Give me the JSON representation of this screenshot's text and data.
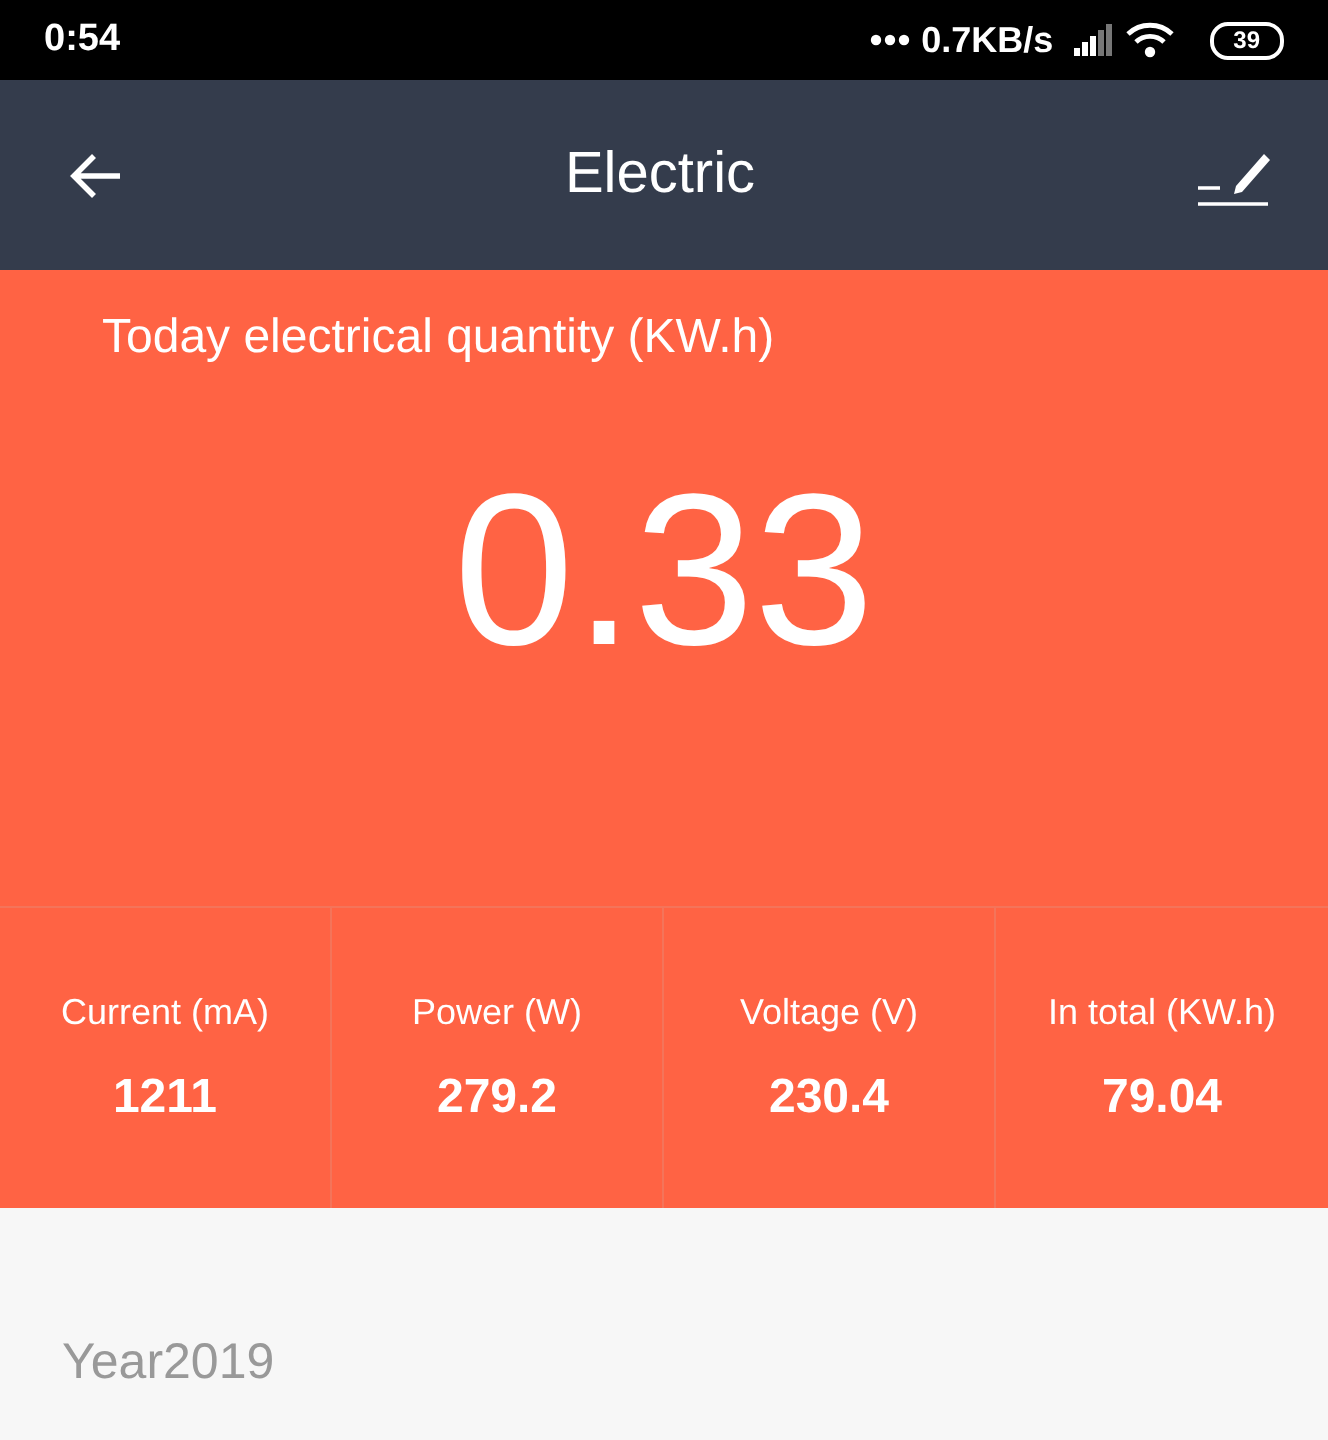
{
  "status_bar": {
    "time": "0:54",
    "network_speed": "0.7KB/s",
    "battery": "39"
  },
  "header": {
    "title": "Electric"
  },
  "today": {
    "label": "Today electrical quantity (KW.h)",
    "value": "0.33"
  },
  "stats": [
    {
      "label": "Current (mA)",
      "value": "1211"
    },
    {
      "label": "Power (W)",
      "value": "279.2"
    },
    {
      "label": "Voltage (V)",
      "value": "230.4"
    },
    {
      "label": "In total (KW.h)",
      "value": "79.04"
    }
  ],
  "history": {
    "year": "Year2019"
  }
}
